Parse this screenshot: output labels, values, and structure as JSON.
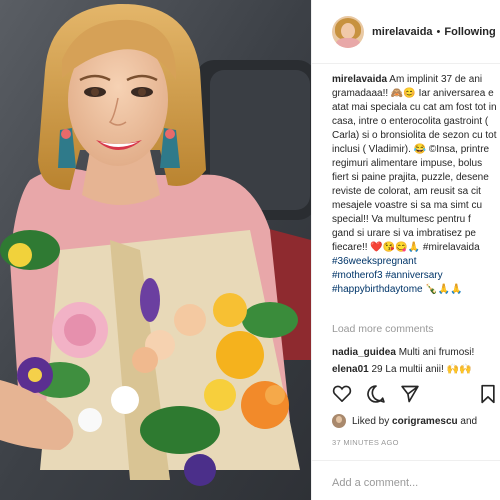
{
  "post": {
    "photo_alt": "",
    "header": {
      "username": "mirelavaida",
      "separator": "•",
      "follow_label": "Following"
    },
    "caption": {
      "username": "mirelavaida",
      "lines": [
        "Am implinit 37 de ani",
        "gramadaaa!! 🙈😊 Iar aniversarea e",
        "atat mai speciala cu cat am fost tot in",
        "casa, intre o enterocolita gastroint (",
        "Carla) si o bronsiolita de sezon cu tot",
        "inclusi ( Vladimir). 😂 ©Insa, printre",
        "regimuri alimentare impuse, bolus",
        "fiert si paine prajita, puzzle, desene",
        "reviste de colorat, am reusit sa cit",
        "mesajele voastre si sa ma simt cu",
        "special!! Va multumesc pentru f",
        "gand si urare si va imbratisez pe",
        "fiecare!! ❤️😘😋🙏 #mirelavaida"
      ],
      "hashtags": [
        "#36weekspregnant",
        "#motherof3 #anniversary",
        "#happybirthdaytome 🍾🙏🙏"
      ]
    },
    "load_more": "Load more comments",
    "comments": [
      {
        "user": "nadia_guidea",
        "text": "Multi ani frumosi!"
      },
      {
        "user": "elena01",
        "text": "29 La multii anii! 🙌🙌"
      }
    ],
    "icons": {
      "like": "heart-icon",
      "comment": "comment-icon",
      "share": "share-icon",
      "save": "bookmark-icon"
    },
    "likes": {
      "prefix": "Liked by",
      "user": "corigramescu",
      "suffix": "and"
    },
    "timestamp": "37 MINUTES AGO",
    "add_comment_placeholder": "Add a comment..."
  },
  "colors": {
    "hashtag": "#003569",
    "muted": "#999999",
    "text": "#262626",
    "divider": "#efefef"
  }
}
